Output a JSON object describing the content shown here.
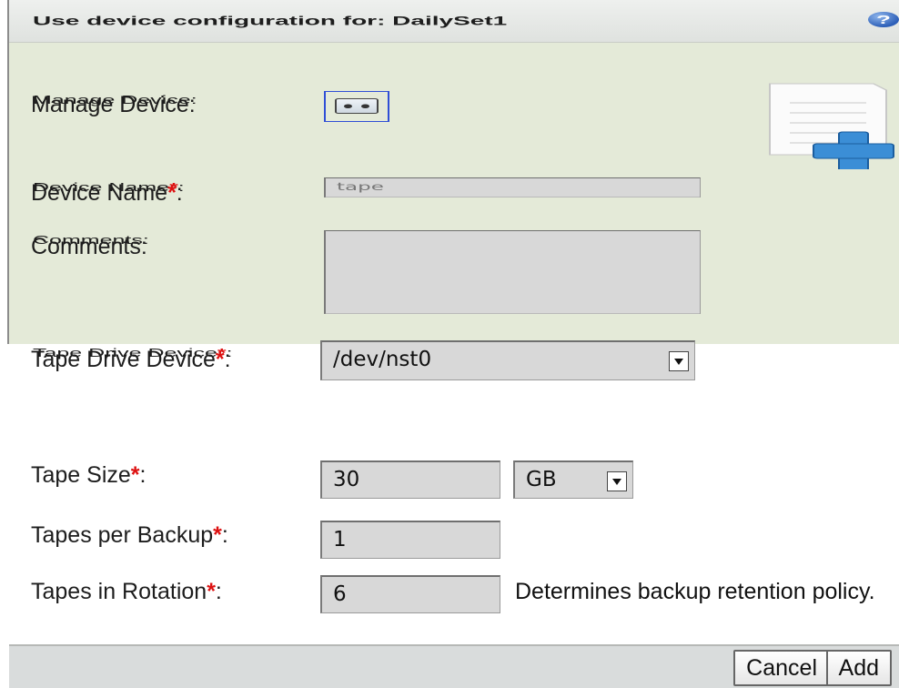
{
  "dialog": {
    "title": "Use device configuration for: DailySet1",
    "help_icon": "help-icon",
    "help_glyph": "?"
  },
  "form": {
    "manage_device_label": "Manage Device:",
    "device_name_label": "Device Name",
    "device_name_value": "tape",
    "comments_label": "Comments:",
    "comments_value": "",
    "tape_drive_label": "Tape Drive Device",
    "tape_drive_value": "/dev/nst0",
    "tape_size_label": "Tape Size",
    "tape_size_value": "30",
    "tape_size_unit": "GB",
    "tapes_per_backup_label": "Tapes per Backup",
    "tapes_per_backup_value": "1",
    "tapes_in_rotation_label": "Tapes in Rotation",
    "tapes_in_rotation_value": "6",
    "rotation_note": "Determines backup retention policy.",
    "required_marker": "*",
    "label_suffix": ":"
  },
  "footer": {
    "cancel_label": "Cancel",
    "add_label": "Add"
  },
  "colors": {
    "panel": "#e4ead8",
    "required": "#dd1111",
    "accent": "#2f4ed6"
  }
}
